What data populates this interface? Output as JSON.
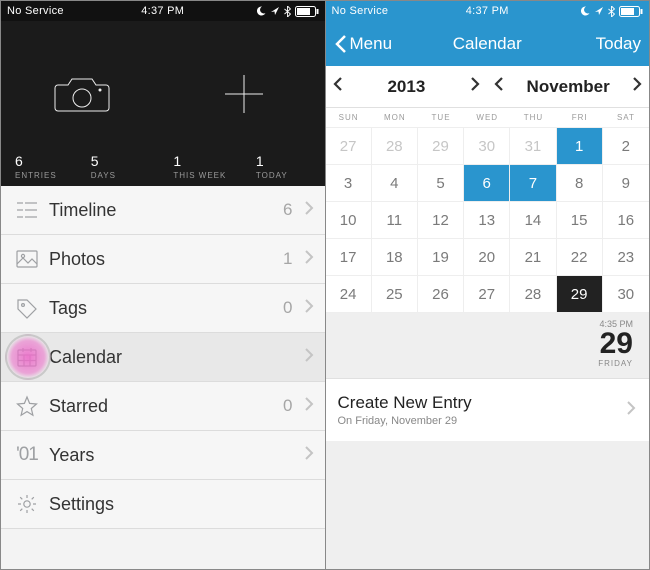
{
  "status": {
    "carrier": "No Service",
    "time": "4:37 PM"
  },
  "phone1": {
    "stats": [
      {
        "n": "6",
        "l": "ENTRIES"
      },
      {
        "n": "5",
        "l": "DAYS"
      },
      {
        "n": "1",
        "l": "THIS WEEK"
      },
      {
        "n": "1",
        "l": "TODAY"
      }
    ],
    "menu": [
      {
        "key": "timeline",
        "label": "Timeline",
        "count": "6"
      },
      {
        "key": "photos",
        "label": "Photos",
        "count": "1"
      },
      {
        "key": "tags",
        "label": "Tags",
        "count": "0"
      },
      {
        "key": "calendar",
        "label": "Calendar",
        "count": ""
      },
      {
        "key": "starred",
        "label": "Starred",
        "count": "0"
      },
      {
        "key": "years",
        "label": "Years",
        "count": ""
      },
      {
        "key": "settings",
        "label": "Settings",
        "count": ""
      }
    ]
  },
  "phone2": {
    "nav": {
      "back": "Menu",
      "title": "Calendar",
      "right": "Today"
    },
    "year": "2013",
    "month": "November",
    "weekdays": [
      "SUN",
      "MON",
      "TUE",
      "WED",
      "THU",
      "FRI",
      "SAT"
    ],
    "days": [
      {
        "d": "27",
        "cls": "other"
      },
      {
        "d": "28",
        "cls": "other"
      },
      {
        "d": "29",
        "cls": "other"
      },
      {
        "d": "30",
        "cls": "other"
      },
      {
        "d": "31",
        "cls": "other"
      },
      {
        "d": "1",
        "cls": "entry"
      },
      {
        "d": "2",
        "cls": ""
      },
      {
        "d": "3",
        "cls": ""
      },
      {
        "d": "4",
        "cls": ""
      },
      {
        "d": "5",
        "cls": ""
      },
      {
        "d": "6",
        "cls": "entry"
      },
      {
        "d": "7",
        "cls": "entry"
      },
      {
        "d": "8",
        "cls": ""
      },
      {
        "d": "9",
        "cls": ""
      },
      {
        "d": "10",
        "cls": ""
      },
      {
        "d": "11",
        "cls": ""
      },
      {
        "d": "12",
        "cls": ""
      },
      {
        "d": "13",
        "cls": ""
      },
      {
        "d": "14",
        "cls": ""
      },
      {
        "d": "15",
        "cls": ""
      },
      {
        "d": "16",
        "cls": ""
      },
      {
        "d": "17",
        "cls": ""
      },
      {
        "d": "18",
        "cls": ""
      },
      {
        "d": "19",
        "cls": ""
      },
      {
        "d": "20",
        "cls": ""
      },
      {
        "d": "21",
        "cls": ""
      },
      {
        "d": "22",
        "cls": ""
      },
      {
        "d": "23",
        "cls": ""
      },
      {
        "d": "24",
        "cls": ""
      },
      {
        "d": "25",
        "cls": ""
      },
      {
        "d": "26",
        "cls": ""
      },
      {
        "d": "27",
        "cls": ""
      },
      {
        "d": "28",
        "cls": ""
      },
      {
        "d": "29",
        "cls": "today"
      },
      {
        "d": "30",
        "cls": ""
      }
    ],
    "current": {
      "time": "4:35 PM",
      "day": "29",
      "weekday": "FRIDAY"
    },
    "create": {
      "title": "Create New Entry",
      "subtitle": "On Friday, November 29"
    }
  }
}
